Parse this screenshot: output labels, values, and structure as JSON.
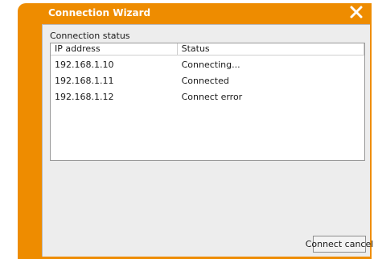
{
  "window": {
    "title": "Connection Wizard",
    "accent_color": "#ee8c00",
    "close_icon": "close-x-icon"
  },
  "connection_status": {
    "section_label": "Connection status",
    "columns": [
      "IP address",
      "Status"
    ],
    "rows": [
      {
        "ip": "192.168.1.10",
        "status": "Connecting..."
      },
      {
        "ip": "192.168.1.11",
        "status": "Connected"
      },
      {
        "ip": "192.168.1.12",
        "status": "Connect error"
      }
    ]
  },
  "actions": {
    "cancel_label": "Connect cancel"
  }
}
